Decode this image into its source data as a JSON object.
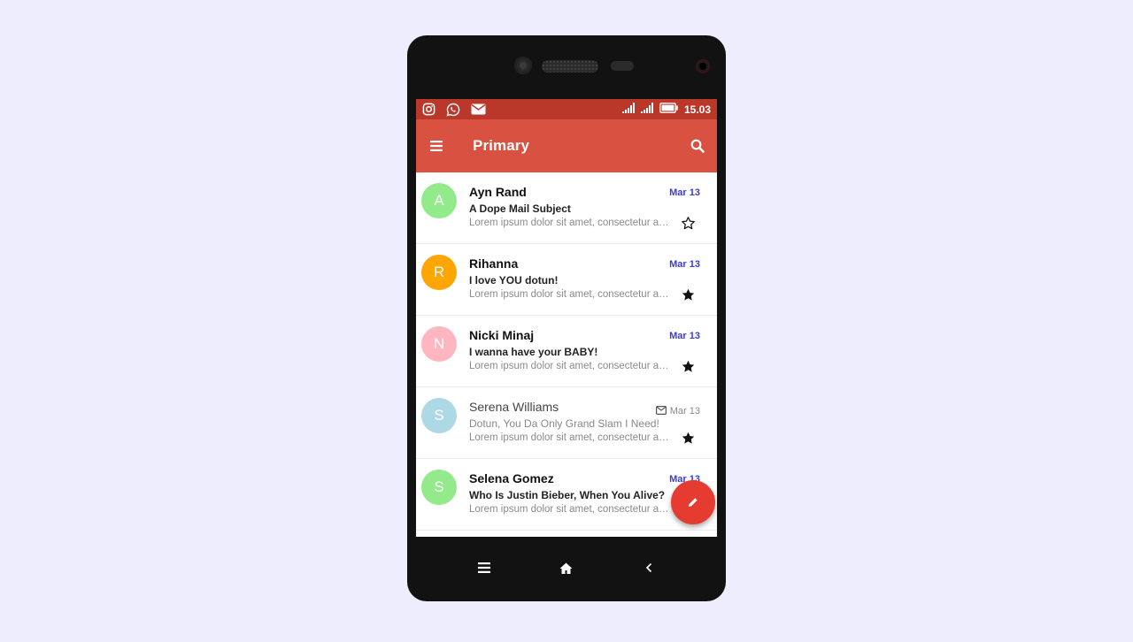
{
  "statusbar": {
    "icons": [
      "instagram-icon",
      "whatsapp-icon",
      "mail-icon"
    ],
    "time": "15.03",
    "colors": {
      "bg": "#b9382a"
    }
  },
  "appbar": {
    "title": "Primary",
    "menu_icon": "menu-icon",
    "search_icon": "search-icon",
    "colors": {
      "bg": "#d95140"
    }
  },
  "mails": [
    {
      "avatar_letter": "A",
      "avatar_color": "#93ea8b",
      "sender": "Ayn Rand",
      "subject": "A Dope Mail Subject",
      "snippet": "Lorem ipsum dolor sit amet, consectetur adipiscing elit",
      "date": "Mar 13",
      "starred": false,
      "read": false
    },
    {
      "avatar_letter": "R",
      "avatar_color": "#ffa500",
      "sender": "Rihanna",
      "subject": "I love YOU dotun!",
      "snippet": "Lorem ipsum dolor sit amet, consectetur adipiscing elit",
      "date": "Mar 13",
      "starred": true,
      "read": false
    },
    {
      "avatar_letter": "N",
      "avatar_color": "#ffb6c1",
      "sender": "Nicki Minaj",
      "subject": "I wanna have your BABY!",
      "snippet": "Lorem ipsum dolor sit amet, consectetur adipiscing elit",
      "date": "Mar 13",
      "starred": true,
      "read": false
    },
    {
      "avatar_letter": "S",
      "avatar_color": "#add8e6",
      "sender": "Serena Williams",
      "subject": "Dotun, You Da Only Grand Slam I Need!",
      "snippet": "Lorem ipsum dolor sit amet, consectetur adipiscing elit",
      "date": "Mar 13",
      "starred": true,
      "read": true
    },
    {
      "avatar_letter": "S",
      "avatar_color": "#93ea8b",
      "sender": "Selena Gomez",
      "subject": "Who Is Justin Bieber, When You Alive?",
      "snippet": "Lorem ipsum dolor sit amet, consectetur adipiscing elit",
      "date": "Mar 13",
      "starred": false,
      "read": false
    }
  ],
  "fab": {
    "icon": "pencil-icon",
    "color": "#e53b30"
  },
  "navbar": {
    "icons": [
      "menu-icon",
      "home-icon",
      "back-icon"
    ]
  },
  "accent": {
    "date_unread": "#3b3bd9"
  }
}
